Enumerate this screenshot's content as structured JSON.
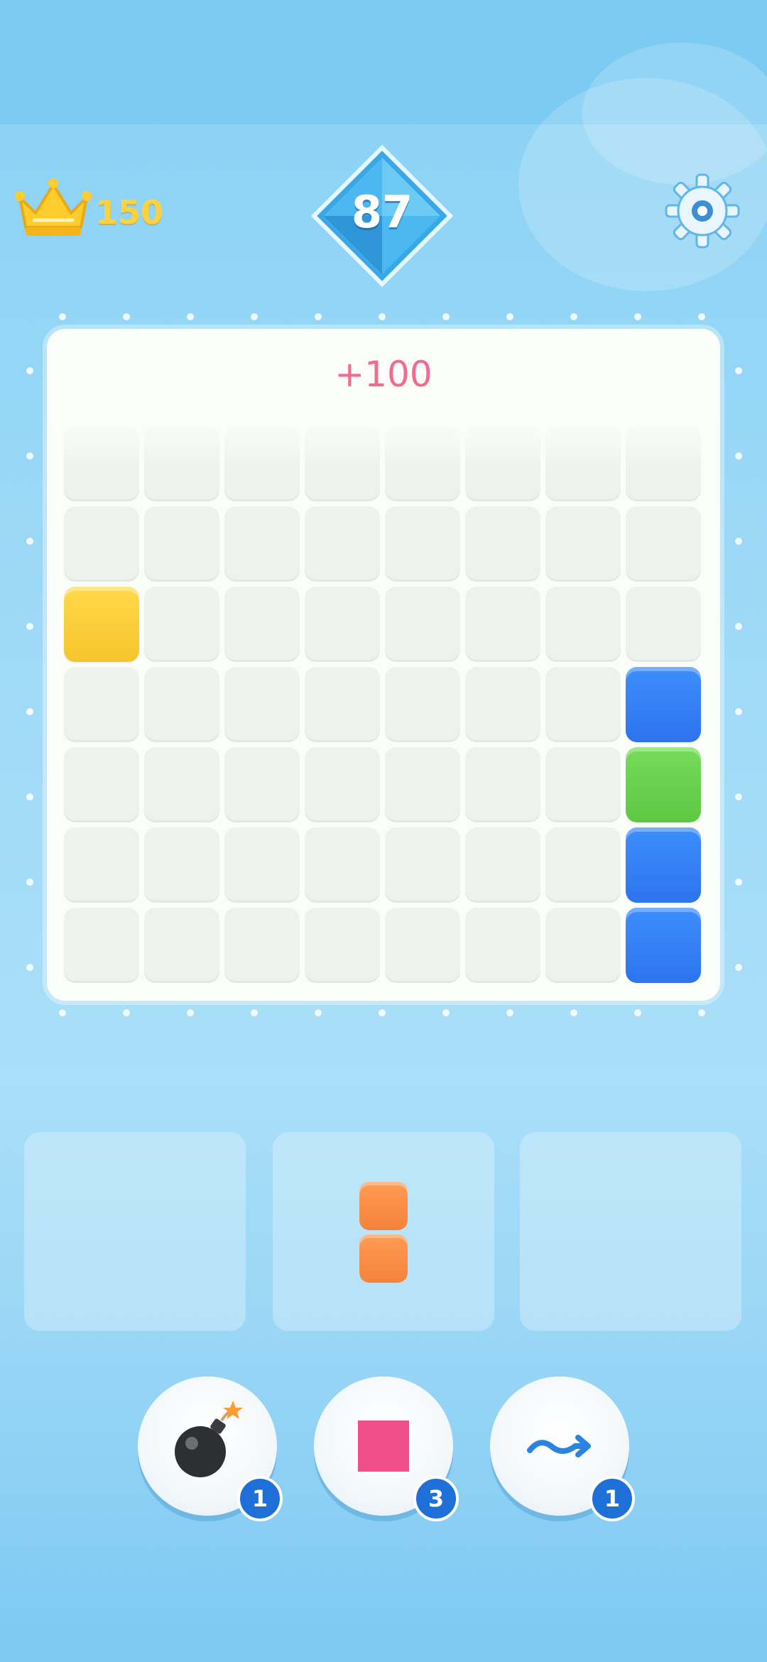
{
  "header": {
    "crown_icon": "crown-icon",
    "best_score": "150",
    "level": "87",
    "settings_icon": "gear-icon"
  },
  "board": {
    "score_popup": "+100",
    "rows": 7,
    "cols": 8,
    "filled_cells": [
      {
        "row": 2,
        "col": 0,
        "color": "yellow"
      },
      {
        "row": 3,
        "col": 7,
        "color": "blue"
      },
      {
        "row": 4,
        "col": 7,
        "color": "green"
      },
      {
        "row": 5,
        "col": 7,
        "color": "blue"
      },
      {
        "row": 6,
        "col": 7,
        "color": "blue"
      }
    ]
  },
  "trays": [
    {
      "piece": null
    },
    {
      "piece": "vertical-2-orange"
    },
    {
      "piece": null
    }
  ],
  "boosters": [
    {
      "icon": "bomb-icon",
      "count": "1"
    },
    {
      "icon": "square-block-icon",
      "count": "3"
    },
    {
      "icon": "wave-arrow-icon",
      "count": "1"
    }
  ],
  "colors": {
    "background": "#9fdaf7",
    "yellow": "#f6c52c",
    "blue": "#2d74ee",
    "green": "#5ec844",
    "orange": "#f5823b",
    "popup": "#f26a8e",
    "score": "#ffd23b",
    "badge": "#1f6fd8"
  }
}
